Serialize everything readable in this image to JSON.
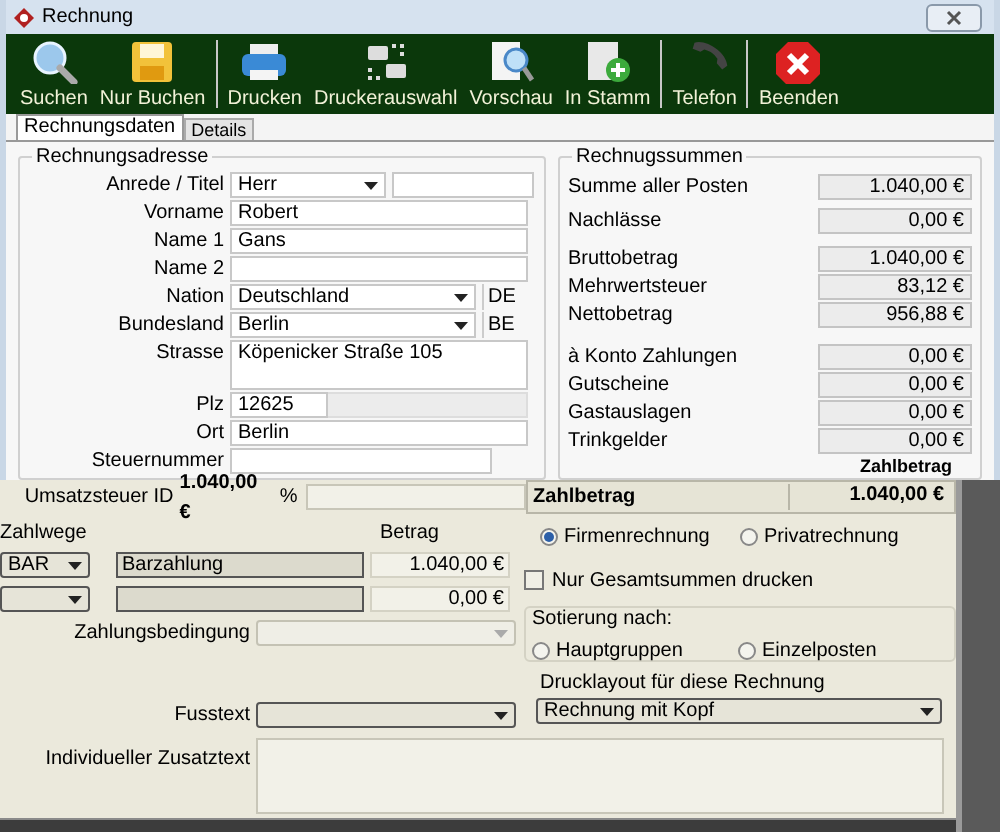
{
  "window": {
    "title": "Rechnung"
  },
  "toolbar_groups": [
    [
      {
        "label": "Suchen",
        "kind": "search"
      },
      {
        "label": "Nur Buchen",
        "kind": "save"
      }
    ],
    [
      {
        "label": "Drucken",
        "kind": "print"
      },
      {
        "label": "Druckerauswahl",
        "kind": "printers"
      },
      {
        "label": "Vorschau",
        "kind": "preview"
      },
      {
        "label": "In Stamm",
        "kind": "add"
      }
    ],
    [
      {
        "label": "Telefon",
        "kind": "phone"
      }
    ],
    [
      {
        "label": "Beenden",
        "kind": "exit"
      }
    ]
  ],
  "tabs": [
    {
      "label": "Rechnungsdaten",
      "selected": true
    },
    {
      "label": "Details",
      "selected": false
    }
  ],
  "address": {
    "title": "Rechnungsadresse",
    "fields": [
      {
        "label": "Anrede / Titel",
        "kind": "combo_pair",
        "value": "Herr"
      },
      {
        "label": "Vorname",
        "kind": "text",
        "value": "Robert"
      },
      {
        "label": "Name 1",
        "kind": "text",
        "value": "Gans"
      },
      {
        "label": "Name 2",
        "kind": "text"
      },
      {
        "label": "Nation",
        "kind": "combo_code",
        "value": "Deutschland",
        "code": "DE"
      },
      {
        "label": "Bundesland",
        "kind": "combo_code",
        "value": "Berlin",
        "code": "BE"
      },
      {
        "label": "Strasse",
        "kind": "multiline",
        "value": "Köpenicker Straße 105"
      },
      {
        "label": "Plz",
        "kind": "short",
        "value": "12625"
      },
      {
        "label": "Ort",
        "kind": "text",
        "value": "Berlin"
      },
      {
        "label": "Steuernummer",
        "kind": "short_wide"
      }
    ]
  },
  "totals": {
    "title": "Rechnugssummen",
    "groups": [
      [
        {
          "label": "Summe aller Posten",
          "value": "1.040,00 €"
        }
      ],
      [
        {
          "label": "Nachlässe",
          "value": "0,00 €"
        }
      ],
      [
        {
          "label": "Bruttobetrag",
          "value": "1.040,00 €"
        },
        {
          "label": "Mehrwertsteuer",
          "value": "83,12 €"
        },
        {
          "label": "Nettobetrag",
          "value": "956,88 €"
        }
      ],
      [
        {
          "label": "à Konto Zahlungen",
          "value": "0,00 €"
        },
        {
          "label": "Gutscheine",
          "value": "0,00 €"
        },
        {
          "label": "Gastauslagen",
          "value": "0,00 €"
        },
        {
          "label": "Trinkgelder",
          "value": "0,00 €"
        }
      ]
    ],
    "footer_label": "Zahlbetrag"
  },
  "lower": {
    "tax_row": {
      "amount": "1.040,00 €",
      "percent": "%",
      "label": "Umsatzsteuer ID"
    },
    "zahlbetrag": {
      "label": "Zahlbetrag",
      "value": "1.040,00 €"
    },
    "payments": {
      "title": "Zahlwege",
      "amount_header": "Betrag",
      "rows": [
        {
          "method": "BAR",
          "description": "Barzahlung",
          "amount": "1.040,00 €"
        },
        {
          "amount": "0,00 €"
        }
      ]
    },
    "payment_terms": {
      "label": "Zahlungsbedingung",
      "disabled": true
    },
    "invoice_type": [
      {
        "label": "Firmenrechnung",
        "selected": true
      },
      {
        "label": "Privatrechnung",
        "selected": false
      }
    ],
    "totals_only": {
      "label": "Nur Gesamtsummen drucken",
      "checked": false
    },
    "sorting": {
      "title": "Sotierung nach:",
      "options": [
        {
          "label": "Hauptgruppen",
          "selected": false
        },
        {
          "label": "Einzelposten",
          "selected": false
        }
      ]
    },
    "print_layout": {
      "label": "Drucklayout für diese Rechnung",
      "value": "Rechnung mit Kopf"
    },
    "footer_text": {
      "label": "Fusstext"
    },
    "extra_text": {
      "label": "Individueller Zusatztext"
    }
  }
}
